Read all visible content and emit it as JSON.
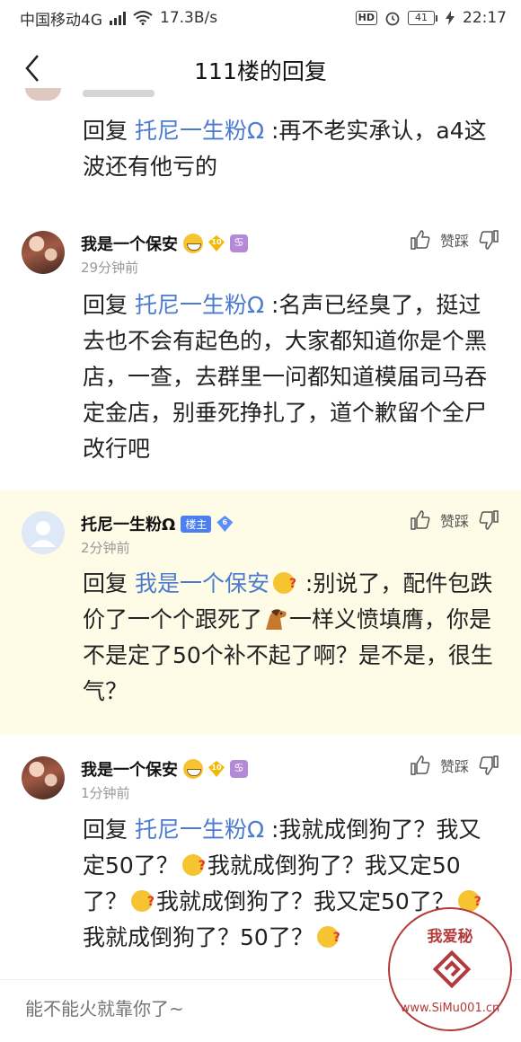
{
  "status_bar": {
    "carrier": "中国移动4G",
    "carrier_sup": "4G",
    "speed": "17.3B/s",
    "hd": "HD",
    "battery": "41",
    "time": "22:17"
  },
  "header": {
    "title": "111楼的回复"
  },
  "first_reply": {
    "prefix": "回复 ",
    "target": "托尼一生粉Ω",
    "text": " :再不老实承认，a4这波还有他亏的"
  },
  "comments": [
    {
      "username": "我是一个保安",
      "level": "10",
      "zodiac": "♋",
      "time": "29分钟前",
      "like_label": "赞踩",
      "prefix": "回复 ",
      "target": "托尼一生粉Ω",
      "text": " :名声已经臭了，挺过去也不会有起色的，大家都知道你是个黑店，一查，去群里一问都知道模届司马吞定金店，别垂死挣扎了，道个歉留个全尸改行吧"
    },
    {
      "username": "托尼一生粉Ω",
      "owner_badge": "楼主",
      "level": "6",
      "time": "2分钟前",
      "like_label": "赞踩",
      "prefix": "回复 ",
      "target": "我是一个保安",
      "text_a": " :别说了，配件包跌价了一个个跟死了",
      "text_b": "一样义愤填膺，你是不是定了50个补不起了啊？是不是，很生气？"
    },
    {
      "username": "我是一个保安",
      "level": "10",
      "zodiac": "♋",
      "time": "1分钟前",
      "like_label": "赞踩",
      "prefix": "回复 ",
      "target": "托尼一生粉Ω",
      "seg1": " :我就成倒狗了？我又定50了？",
      "seg2": "我就成倒狗了？我又定50了？",
      "seg3": "我就成倒狗了？我又定50了？",
      "seg4": "我就成倒狗了？",
      "seg5": "50了？"
    }
  ],
  "input": {
    "placeholder": "能不能火就靠你了~"
  },
  "watermark": {
    "top": "我爱秘",
    "bottom": "www.SiMu001.cn"
  },
  "colors": {
    "link": "#4a7bd0",
    "highlight_bg": "#fefbe7",
    "owner_badge": "#4c7ff0"
  }
}
